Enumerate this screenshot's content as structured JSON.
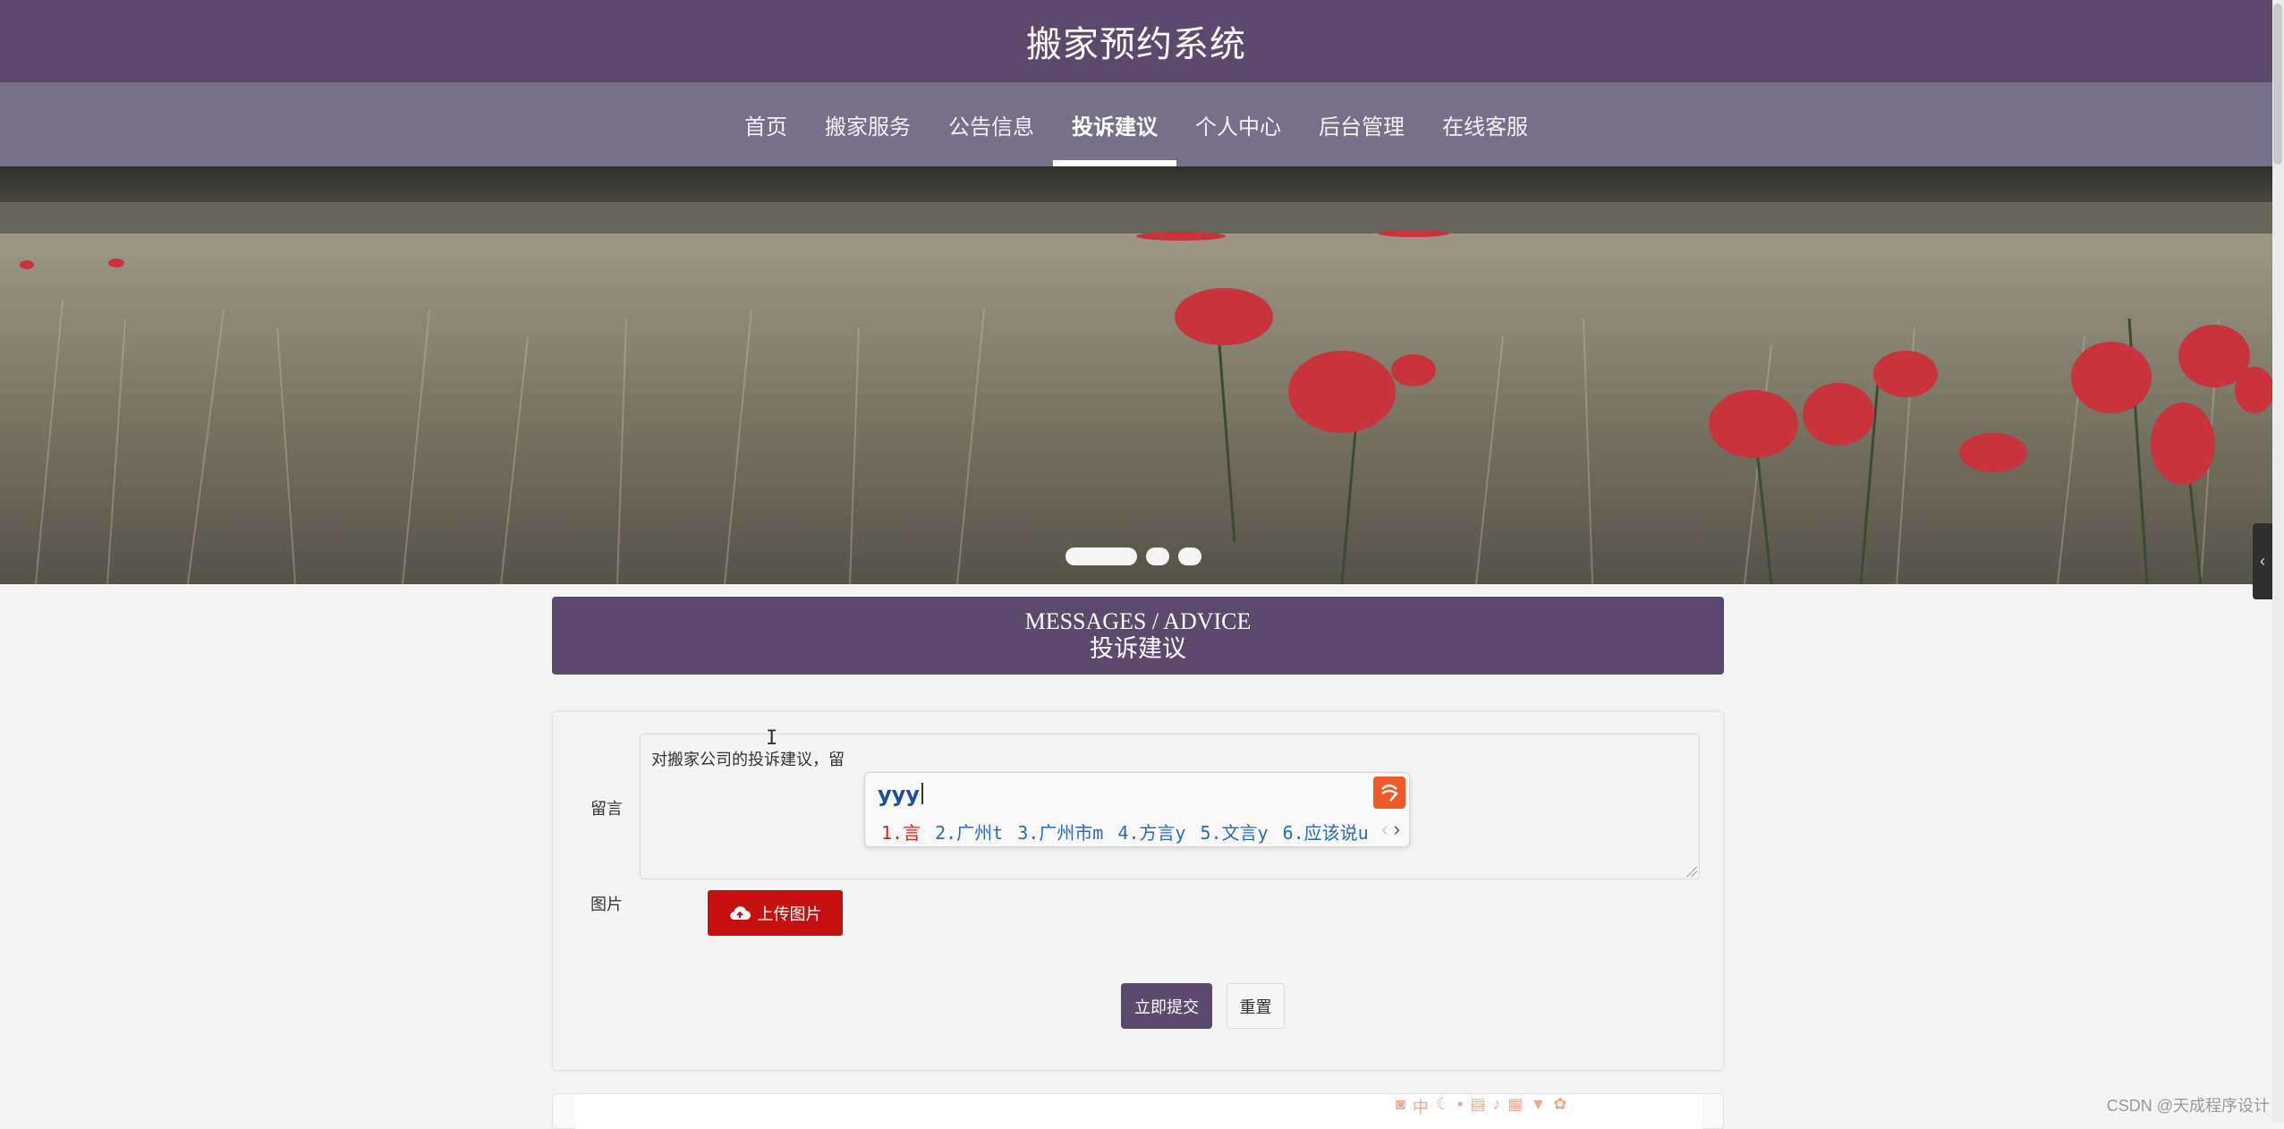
{
  "header": {
    "title": "搬家预约系统"
  },
  "nav": {
    "items": [
      {
        "label": "首页"
      },
      {
        "label": "搬家服务"
      },
      {
        "label": "公告信息"
      },
      {
        "label": "投诉建议",
        "active": true
      },
      {
        "label": "个人中心"
      },
      {
        "label": "后台管理"
      },
      {
        "label": "在线客服"
      }
    ]
  },
  "section": {
    "title_en": "MESSAGES / ADVICE",
    "title_cn": "投诉建议"
  },
  "form": {
    "message_label": "留言",
    "message_value": "对搬家公司的投诉建议，留",
    "image_label": "图片",
    "upload_label": "上传图片",
    "submit_label": "立即提交",
    "reset_label": "重置"
  },
  "ime": {
    "input": "yyy",
    "candidates": [
      "1.言",
      "2.广州t",
      "3.广州市m",
      "4.方言y",
      "5.文言y",
      "6.应该说u"
    ],
    "prev_arrow": "‹",
    "next_arrow": "›"
  },
  "watermark": "CSDN @天成程序设计",
  "colors": {
    "brand": "#5b4a6e",
    "nav_bg": "#77708a",
    "upload_red": "#c6100f"
  },
  "icons": {
    "upload": "cloud-upload-icon",
    "side_tab": "chevron-left-icon",
    "ime_logo": "sogou-logo-icon"
  }
}
